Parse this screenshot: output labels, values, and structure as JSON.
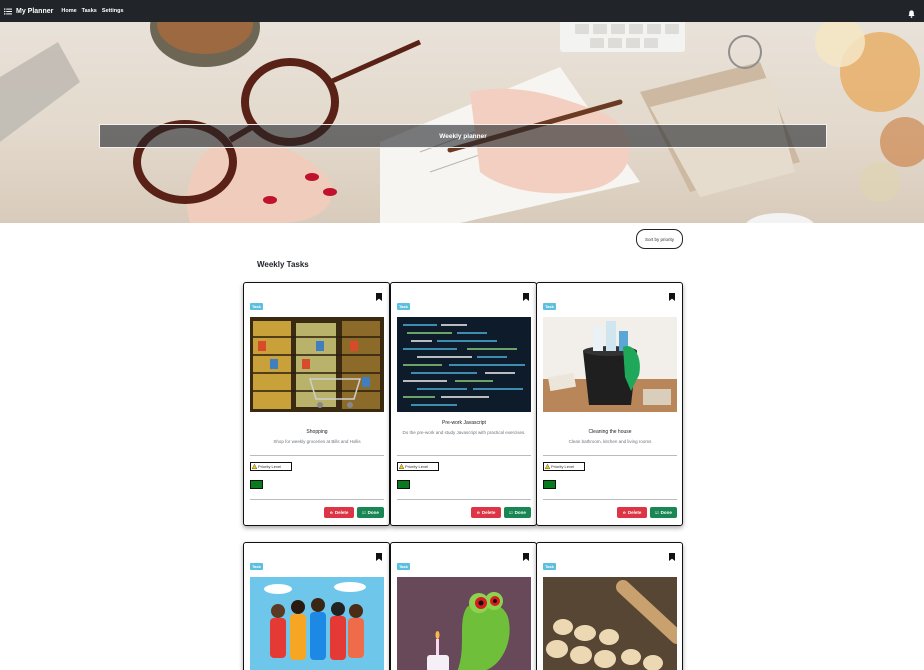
{
  "nav": {
    "brand": "My Planner",
    "links": [
      "Home",
      "Tasks",
      "Settings"
    ],
    "icons": {
      "brand": "list-icon",
      "notifications": "bell-icon"
    }
  },
  "hero": {
    "title": "Weekly planner"
  },
  "sort": {
    "label": "Sort by priority"
  },
  "section": {
    "title": "Weekly Tasks"
  },
  "cards": [
    {
      "tag": "Task",
      "title": "Shopping",
      "text": "Shop for weekly groceries at Bills and Hollis",
      "priority_label": "Priority Level",
      "delete_label": "Delete",
      "done_label": "Done"
    },
    {
      "tag": "Task",
      "title": "Pre-work Javascript",
      "text": "Do the pre-work and study Javascript with practical exercises.",
      "priority_label": "Priority Level",
      "delete_label": "Delete",
      "done_label": "Done"
    },
    {
      "tag": "Task",
      "title": "Cleaning the house",
      "text": "Clean bathroom, kitchen and living rooms",
      "priority_label": "Priority Level",
      "delete_label": "Delete",
      "done_label": "Done"
    },
    {
      "tag": "Task"
    },
    {
      "tag": "Task"
    },
    {
      "tag": "Task"
    }
  ],
  "colors": {
    "navbar": "#212529",
    "tag": "#5bc0de",
    "delete": "#dc3545",
    "done": "#198754",
    "priority_indicator": "#0a7a1e"
  }
}
